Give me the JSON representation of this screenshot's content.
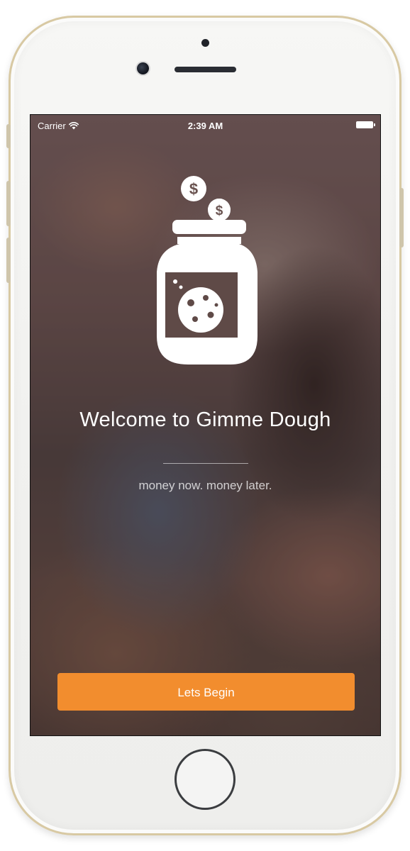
{
  "status_bar": {
    "carrier": "Carrier",
    "time": "2:39 AM"
  },
  "welcome": {
    "title": "Welcome to Gimme Dough",
    "tagline": "money now. money later."
  },
  "cta": {
    "label": "Lets Begin",
    "color": "#f28d2e"
  },
  "icons": {
    "logo": "cookie-jar-with-coins-icon",
    "wifi": "wifi-icon",
    "battery": "battery-icon"
  }
}
